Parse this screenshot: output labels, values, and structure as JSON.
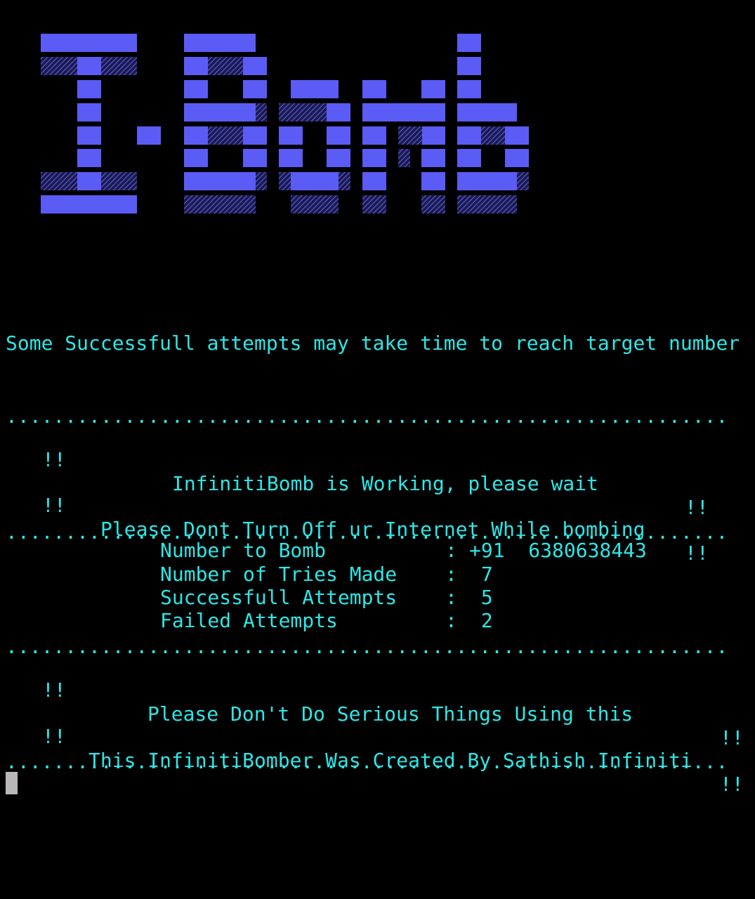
{
  "terminal": {
    "colors": {
      "background": "#000000",
      "text": "#2ee6e6",
      "banner": "#5b5bf5",
      "cursor": "#b8b8b8"
    },
    "banner_text": "I-Bomb",
    "notice": "Some Successfull attempts may take time to reach target number",
    "separator": ".............................................................",
    "status": {
      "bang": "!!",
      "line1": "InfinitiBomb is Working, please wait",
      "line2": "Please Dont Turn Off ur Internet While bombing"
    },
    "stats": [
      {
        "label": "Number to Bomb",
        "sep": ":",
        "value": "+91  6380638443"
      },
      {
        "label": "Number of Tries Made",
        "sep": ":",
        "value": " 7"
      },
      {
        "label": "Successfull Attempts",
        "sep": ":",
        "value": " 5"
      },
      {
        "label": "Failed Attempts",
        "sep": ":",
        "value": " 2"
      }
    ],
    "footer": {
      "line1": "Please Don't Do Serious Things Using this",
      "line2": "This InfinitiBomber Was Created By Sathish Infiniti"
    }
  }
}
